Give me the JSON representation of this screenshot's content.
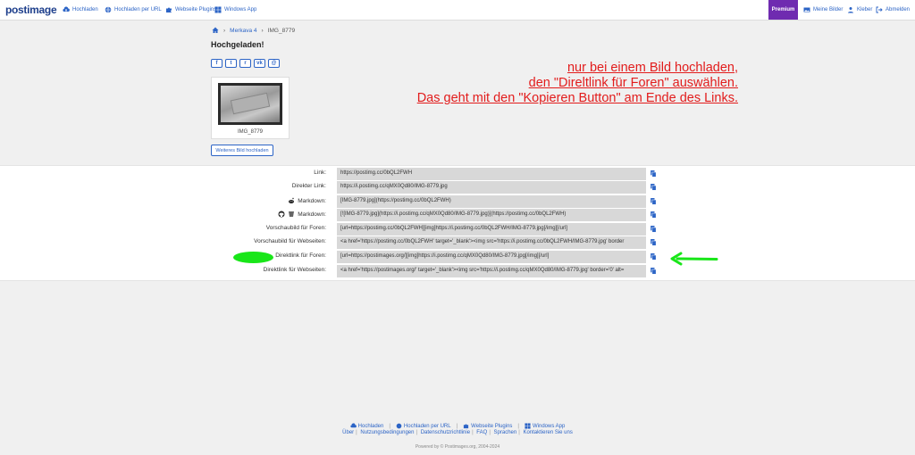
{
  "header": {
    "logo": "postimage",
    "nav": [
      {
        "label": "Hochladen",
        "icon": "cloud-upload-icon"
      },
      {
        "label": "Hochladen per URL",
        "icon": "globe-icon"
      },
      {
        "label": "Webseite Plugins",
        "icon": "puzzle-icon"
      },
      {
        "label": "Windows App",
        "icon": "windows-icon"
      }
    ],
    "premium": "Premium",
    "right_nav": [
      {
        "label": "Meine Bilder",
        "icon": "image-icon"
      },
      {
        "label": "Kleber",
        "icon": "user-icon"
      },
      {
        "label": "Abmelden",
        "icon": "logout-icon"
      }
    ]
  },
  "breadcrumb": {
    "home_icon": "home-icon",
    "parent": "Merkava 4",
    "current": "IMG_8779"
  },
  "page_title": "Hochgeladen!",
  "share": [
    {
      "label": "f",
      "icon": "facebook-icon"
    },
    {
      "label": "t",
      "icon": "twitter-icon"
    },
    {
      "label": "r",
      "icon": "reddit-icon"
    },
    {
      "label": "vk",
      "icon": "vk-icon"
    },
    {
      "label": "@",
      "icon": "email-icon"
    }
  ],
  "thumbnail": {
    "caption": "IMG_8779"
  },
  "more_button": "Weiteres Bild hochladen",
  "annotation": {
    "lines": [
      "nur bei einem Bild hochladen,",
      "den \"Direltlink für Foren\" auswählen.",
      "Das geht mit den \"Kopieren Button\" am Ende des Links."
    ],
    "color": "#e21c1c"
  },
  "links": [
    {
      "label": "Link:",
      "value": "https://postimg.cc/0bQL2FWH"
    },
    {
      "label": "Direkter Link:",
      "value": "https://i.postimg.cc/qMX0Qd80/IMG-8779.jpg"
    },
    {
      "label": "Markdown:",
      "value": "[IMG-8779.jpg](https://postimg.cc/0bQL2FWH)",
      "icon": "reddit-icon"
    },
    {
      "label": "Markdown:",
      "value": "[![IMG-8779.jpg](https://i.postimg.cc/qMX0Qd80/IMG-8779.jpg)](https://postimg.cc/0bQL2FWH)",
      "icon": "github-icon"
    },
    {
      "label": "Vorschaubild für Foren:",
      "value": "[url=https://postimg.cc/0bQL2FWH][img]https://i.postimg.cc/0bQL2FWH/IMG-8779.jpg[/img][/url]"
    },
    {
      "label": "Vorschaubild für Webseiten:",
      "value": "<a href='https://postimg.cc/0bQL2FWH' target='_blank'><img src='https://i.postimg.cc/0bQL2FWH/IMG-8779.jpg' border"
    },
    {
      "label": "Direktlink für Foren:",
      "value": "[url=https://postimages.org/][img]https://i.postimg.cc/qMX0Qd80/IMG-8779.jpg[/img][/url]"
    },
    {
      "label": "Direktlink für Webseiten:",
      "value": "<a href='https://postimages.org/' target='_blank'><img src='https://i.postimg.cc/qMX0Qd80/IMG-8779.jpg' border='0' alt="
    }
  ],
  "footer": {
    "nav": [
      "Hochladen",
      "Hochladen per URL",
      "Webseite Plugins",
      "Windows App"
    ],
    "links": [
      "Über",
      "Nutzungsbedingungen",
      "Datenschutzrichtlinie",
      "FAQ",
      "Sprachen",
      "Kontaktieren Sie uns"
    ],
    "copyright": "Powered by © Postimages.org, 2004-2024"
  },
  "colors": {
    "accent": "#2c64c6",
    "premium": "#6f2bb0",
    "highlight_green": "#19e619"
  }
}
